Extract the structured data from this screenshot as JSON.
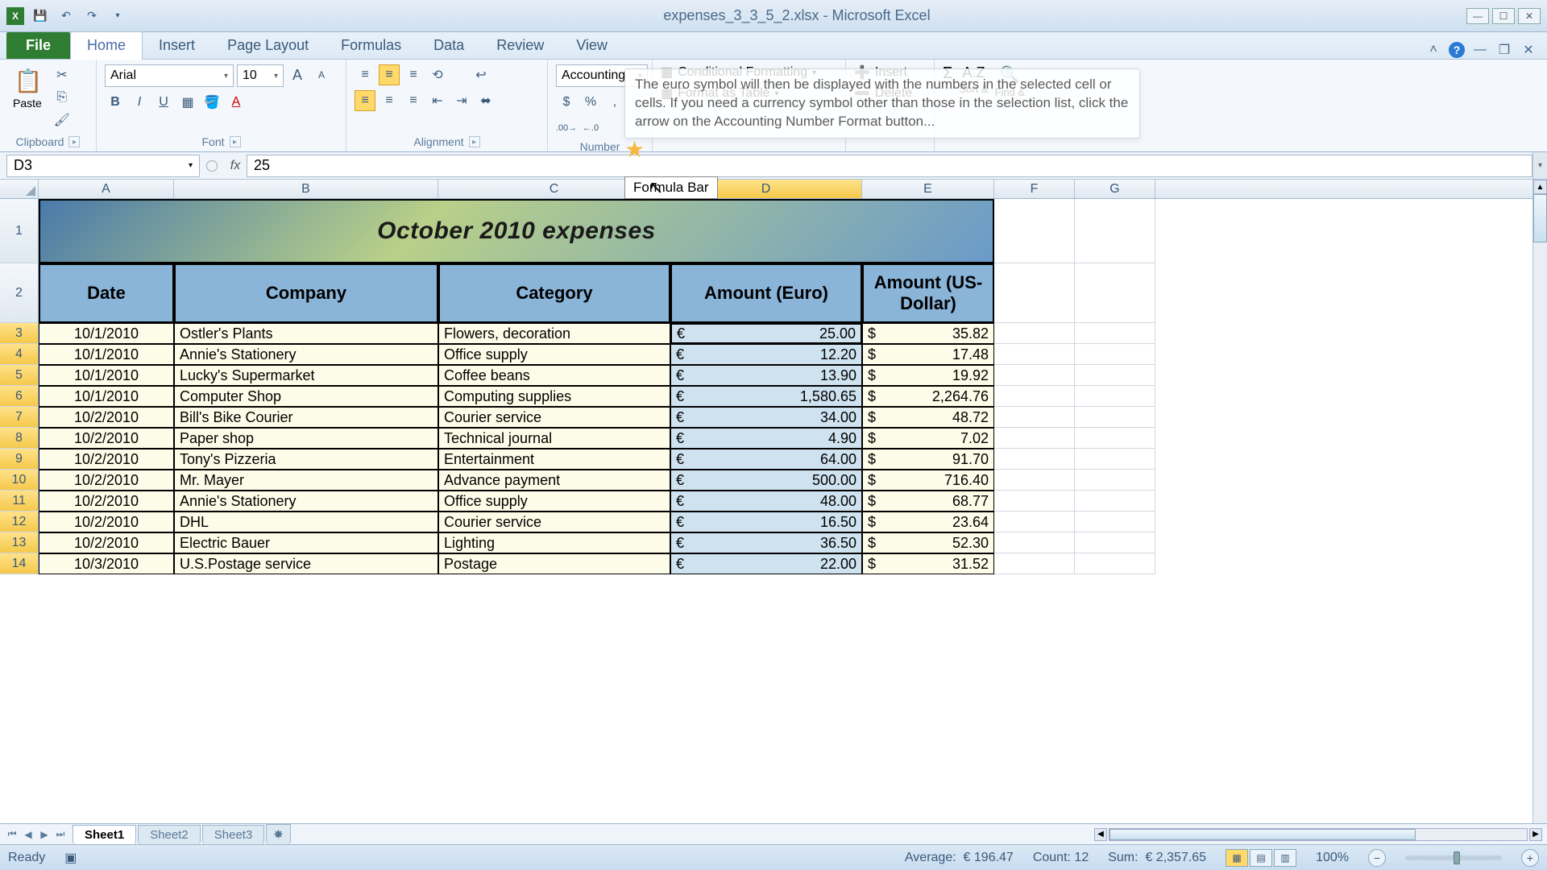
{
  "app": {
    "title": "expenses_3_3_5_2.xlsx - Microsoft Excel"
  },
  "tabs": {
    "file": "File",
    "home": "Home",
    "insert": "Insert",
    "page_layout": "Page Layout",
    "formulas": "Formulas",
    "data": "Data",
    "review": "Review",
    "view": "View"
  },
  "ribbon": {
    "clipboard": {
      "label": "Clipboard",
      "paste": "Paste"
    },
    "font": {
      "label": "Font",
      "name": "Arial",
      "size": "10"
    },
    "alignment": {
      "label": "Alignment"
    },
    "number": {
      "label": "Number",
      "format": "Accounting"
    },
    "styles": {
      "cond": "Conditional Formatting",
      "table": "Format as Table"
    },
    "cells": {
      "insert": "Insert",
      "delete": "Delete"
    },
    "editing": {
      "sort": "Sort &",
      "find": "Find &"
    }
  },
  "tooltip": {
    "text": "The euro symbol will then be displayed with the numbers in the selected cell or cells. If you need a currency symbol other than those in the selection list, click the arrow on the Accounting Number Format button...",
    "fbar_label": "Formula Bar"
  },
  "namebox": {
    "ref": "D3"
  },
  "formula": {
    "value": "25"
  },
  "columns": [
    "A",
    "B",
    "C",
    "D",
    "E",
    "F",
    "G"
  ],
  "sheet": {
    "title": "October 2010 expenses",
    "headers": {
      "date": "Date",
      "company": "Company",
      "category": "Category",
      "euro": "Amount (Euro)",
      "usd": "Amount (US-Dollar)"
    },
    "rows": [
      {
        "n": 3,
        "date": "10/1/2010",
        "company": "Ostler's Plants",
        "category": "Flowers, decoration",
        "euro": "25.00",
        "usd": "35.82"
      },
      {
        "n": 4,
        "date": "10/1/2010",
        "company": "Annie's Stationery",
        "category": "Office supply",
        "euro": "12.20",
        "usd": "17.48"
      },
      {
        "n": 5,
        "date": "10/1/2010",
        "company": "Lucky's Supermarket",
        "category": "Coffee beans",
        "euro": "13.90",
        "usd": "19.92"
      },
      {
        "n": 6,
        "date": "10/1/2010",
        "company": "Computer Shop",
        "category": "Computing supplies",
        "euro": "1,580.65",
        "usd": "2,264.76"
      },
      {
        "n": 7,
        "date": "10/2/2010",
        "company": "Bill's Bike Courier",
        "category": "Courier service",
        "euro": "34.00",
        "usd": "48.72"
      },
      {
        "n": 8,
        "date": "10/2/2010",
        "company": "Paper shop",
        "category": "Technical journal",
        "euro": "4.90",
        "usd": "7.02"
      },
      {
        "n": 9,
        "date": "10/2/2010",
        "company": "Tony's Pizzeria",
        "category": "Entertainment",
        "euro": "64.00",
        "usd": "91.70"
      },
      {
        "n": 10,
        "date": "10/2/2010",
        "company": "Mr. Mayer",
        "category": "Advance payment",
        "euro": "500.00",
        "usd": "716.40"
      },
      {
        "n": 11,
        "date": "10/2/2010",
        "company": "Annie's Stationery",
        "category": "Office supply",
        "euro": "48.00",
        "usd": "68.77"
      },
      {
        "n": 12,
        "date": "10/2/2010",
        "company": "DHL",
        "category": "Courier service",
        "euro": "16.50",
        "usd": "23.64"
      },
      {
        "n": 13,
        "date": "10/2/2010",
        "company": "Electric Bauer",
        "category": "Lighting",
        "euro": "36.50",
        "usd": "52.30"
      },
      {
        "n": 14,
        "date": "10/3/2010",
        "company": "U.S.Postage service",
        "category": "Postage",
        "euro": "22.00",
        "usd": "31.52"
      }
    ]
  },
  "sheets": {
    "s1": "Sheet1",
    "s2": "Sheet2",
    "s3": "Sheet3"
  },
  "status": {
    "ready": "Ready",
    "avg_label": "Average:",
    "avg": "€ 196.47",
    "count_label": "Count:",
    "count": "12",
    "sum_label": "Sum:",
    "sum": "€ 2,357.65",
    "zoom": "100%"
  }
}
